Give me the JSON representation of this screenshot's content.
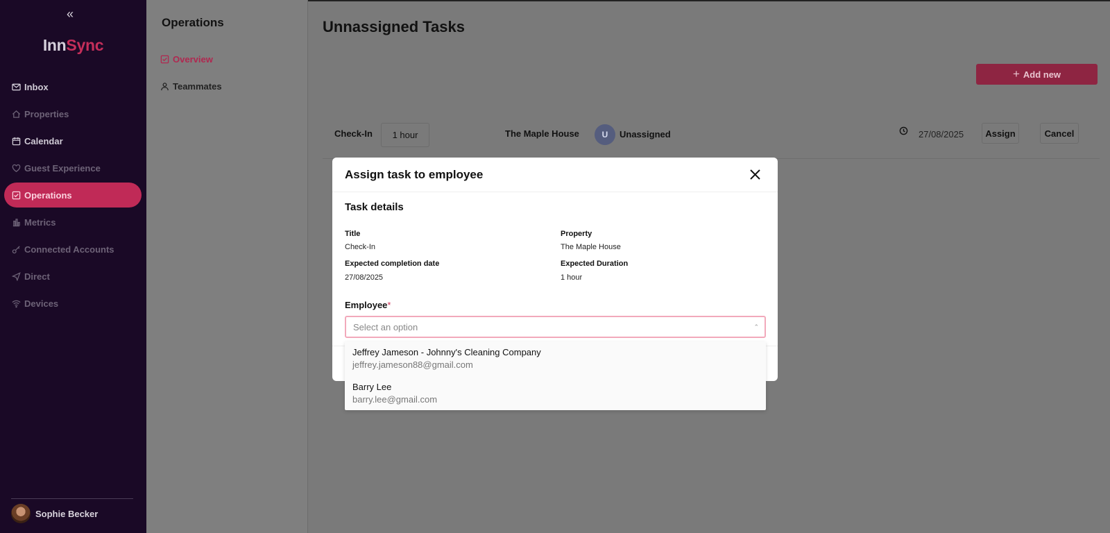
{
  "app": {
    "logo_part1": "Inn",
    "logo_part2": "Sync",
    "collapse_icon": "«"
  },
  "sidebar": {
    "items": [
      {
        "label": "Inbox",
        "icon": "mail-icon"
      },
      {
        "label": "Properties",
        "icon": "home-icon"
      },
      {
        "label": "Calendar",
        "icon": "calendar-icon"
      },
      {
        "label": "Guest Experience",
        "icon": "heart-icon"
      },
      {
        "label": "Operations",
        "icon": "checkbox-icon"
      },
      {
        "label": "Metrics",
        "icon": "bar-chart-icon"
      },
      {
        "label": "Connected Accounts",
        "icon": "key-icon"
      },
      {
        "label": "Direct",
        "icon": "send-icon"
      },
      {
        "label": "Devices",
        "icon": "wifi-icon"
      }
    ],
    "selected": "Operations",
    "user": {
      "name": "Sophie Becker"
    }
  },
  "subnav": {
    "title": "Operations",
    "items": [
      {
        "label": "Overview",
        "icon": "checkbox-icon"
      },
      {
        "label": "Teammates",
        "icon": "user-icon"
      }
    ]
  },
  "main": {
    "title": "Unnassigned Tasks",
    "add_button": "Add new",
    "task": {
      "title": "Check-In",
      "duration": "1 hour",
      "property": "The Maple House",
      "avatar_letter": "U",
      "assignee": "Unassigned",
      "date": "27/08/2025",
      "assign_label": "Assign",
      "cancel_label": "Cancel"
    }
  },
  "modal": {
    "title": "Assign task to employee",
    "section_title": "Task details",
    "fields": {
      "title_label": "Title",
      "title_value": "Check-In",
      "property_label": "Property",
      "property_value": "The Maple House",
      "date_label": "Expected completion date",
      "date_value": "27/08/2025",
      "duration_label": "Expected Duration",
      "duration_value": "1 hour"
    },
    "employee_label": "Employee",
    "required_mark": "*",
    "select_placeholder": "Select an option",
    "options": [
      {
        "name": "Jeffrey Jameson - Johnny's Cleaning Company",
        "email": "jeffrey.jameson88@gmail.com"
      },
      {
        "name": "Barry Lee",
        "email": "barry.lee@gmail.com"
      }
    ]
  },
  "colors": {
    "sidebar_bg": "#1a0926",
    "accent": "#c02a57",
    "overlay": "#7a7a7a"
  }
}
